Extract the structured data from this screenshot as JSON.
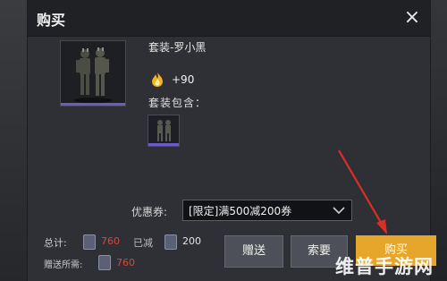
{
  "dialog": {
    "title": "购买",
    "close": "×"
  },
  "item": {
    "name": "套装-罗小黑",
    "bonus": "+90",
    "contains_label": "套装包含：",
    "icon": "outfit-figure-icon",
    "rarity_color": "#6a5cc8"
  },
  "coupon": {
    "label": "优惠券:",
    "selected": "[限定]满500减200券"
  },
  "footer": {
    "total_label": "总计:",
    "total_price": "760",
    "discount_label": "已减",
    "discount_value": "200",
    "gift_cost_label": "赠送所需:",
    "gift_cost": "760"
  },
  "buttons": {
    "gift": "赠送",
    "request": "索要",
    "buy": "购买"
  },
  "colors": {
    "accent_buy": "#e6a62c",
    "price_red": "#d14a3c",
    "annotation_arrow": "#d93025"
  },
  "watermark": "维普手游网"
}
